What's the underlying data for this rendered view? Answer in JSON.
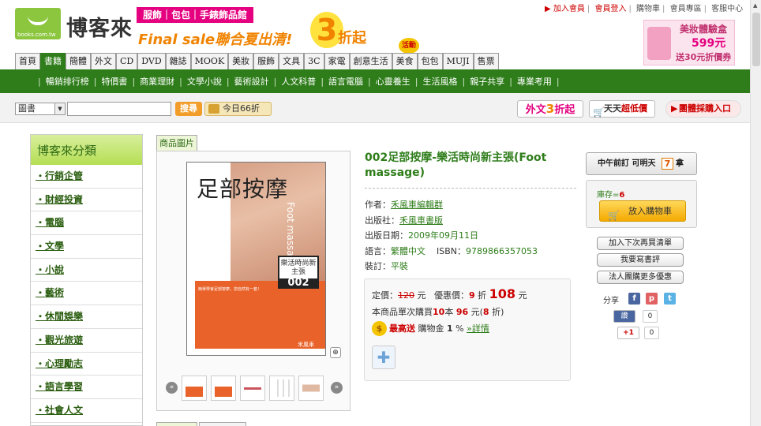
{
  "brand": {
    "name": "博客來",
    "url": "books.com.tw"
  },
  "promo": {
    "tag": "服飾｜包包｜手錶飾品館",
    "final": "Final sale聯合夏出清!",
    "digit": "3",
    "zhe": "折起",
    "badge": "活動"
  },
  "toplinks": [
    "加入會員",
    "會員登入",
    "購物車",
    "會員專區",
    "客服中心"
  ],
  "ad": {
    "title": "美妝體驗盒",
    "price": "599元",
    "sub": "送30元折價券"
  },
  "tabs": [
    "首頁",
    "書籍",
    "簡體",
    "外文",
    "CD",
    "DVD",
    "雜誌",
    "MOOK",
    "美妝",
    "服飾",
    "文具",
    "3C",
    "家電",
    "創意生活",
    "美食",
    "包包",
    "MUJI",
    "售票"
  ],
  "subnav": [
    "暢銷排行榜",
    "特價書",
    "商業理財",
    "文學小說",
    "藝術設計",
    "人文科普",
    "語言電腦",
    "心靈養生",
    "生活風格",
    "親子共享",
    "專業考用"
  ],
  "search": {
    "category": "圖書",
    "button": "搜尋",
    "today": "今日66折"
  },
  "right_buttons": {
    "foreign_a": "外文",
    "foreign_num": "3",
    "foreign_b": "折起",
    "daily_a": "天天",
    "daily_b": "超低價",
    "group": "團體採購入口"
  },
  "sidebar": {
    "title": "博客來分類",
    "items": [
      "行銷企管",
      "財經投資",
      "電腦",
      "文學",
      "小說",
      "藝術",
      "休閒娛樂",
      "觀光旅遊",
      "心理勵志",
      "語言學習",
      "社會人文"
    ]
  },
  "image_tab": "商品圖片",
  "cover": {
    "title": "足部按摩",
    "subtitle": "Foot massage",
    "badge_top": "樂活時尚新主張",
    "badge_num": "002",
    "blurb": "簡單學會足部按摩，您自然有一套！",
    "publisher": "禾風車"
  },
  "product": {
    "title": "002足部按摩-樂活時尚新主張(Foot massage)",
    "author_label": "作者：",
    "author": "禾風車編輯群",
    "publisher_label": "出版社：",
    "publisher": "禾風車書版",
    "date_label": "出版日期：",
    "date": "2009年09月11日",
    "lang_label": "語言：",
    "lang": "繁體中文",
    "isbn_label": "ISBN：",
    "isbn": "9789866357053",
    "binding_label": "裝訂：",
    "binding": "平裝"
  },
  "price": {
    "list_label": "定價：",
    "list": "120",
    "unit": "元",
    "sale_label": "優惠價：",
    "discount": "9",
    "zhe": "折",
    "sale": "108",
    "limit_a": "本商品單次購買",
    "limit_n": "10",
    "limit_b": "本",
    "limit_p": "96",
    "limit_c": "元(",
    "limit_d": "8",
    "limit_e": "折)",
    "reward_a": "最高送",
    "reward_b": "購物金",
    "reward_n": "1",
    "reward_c": "%",
    "reward_link": "»詳情"
  },
  "delivery": {
    "text": "中午前訂 可明天",
    "seven": "7",
    "pickup": "拿"
  },
  "stock": {
    "label": "庫存=",
    "value": "6"
  },
  "cart_label": "放入購物車",
  "actions": [
    "加入下次再買清單",
    "我要寫書評",
    "法人團購更多優惠"
  ],
  "share": {
    "label": "分享",
    "fb": "讚",
    "fb_count": "0",
    "g": "+1",
    "g_count": "0"
  }
}
